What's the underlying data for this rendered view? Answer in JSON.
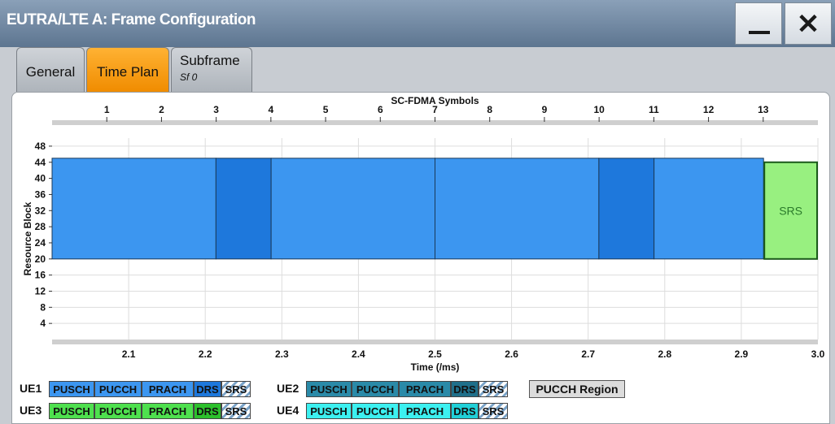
{
  "window": {
    "title": "EUTRA/LTE A: Frame Configuration"
  },
  "tabs": {
    "general": "General",
    "time_plan": "Time Plan",
    "subframe": "Subframe",
    "subframe_value": "Sf 0"
  },
  "chart_data": {
    "type": "timeplan",
    "top_axis_label": "SC-FDMA Symbols",
    "top_ticks": [
      1,
      2,
      3,
      4,
      5,
      6,
      7,
      8,
      9,
      10,
      11,
      12,
      13
    ],
    "xlabel": "Time (/ms)",
    "x_ticks": [
      "2.1",
      "2.2",
      "2.3",
      "2.4",
      "2.5",
      "2.6",
      "2.7",
      "2.8",
      "2.9",
      "3.0"
    ],
    "xlim": [
      2.0,
      3.0
    ],
    "ylabel": "Resource Block",
    "y_ticks": [
      4,
      8,
      12,
      16,
      20,
      24,
      28,
      32,
      36,
      40,
      44,
      48
    ],
    "ylim": [
      0,
      50
    ],
    "allocations": [
      {
        "channel": "PUSCH",
        "t_start": 2.0,
        "t_end": 2.214,
        "rb_start": 20,
        "rb_end": 45,
        "color": "#3c96f0"
      },
      {
        "channel": "DRS",
        "t_start": 2.214,
        "t_end": 2.286,
        "rb_start": 20,
        "rb_end": 45,
        "color": "#1e78dc"
      },
      {
        "channel": "PUSCH",
        "t_start": 2.286,
        "t_end": 2.5,
        "rb_start": 20,
        "rb_end": 45,
        "color": "#3c96f0"
      },
      {
        "channel": "PUSCH",
        "t_start": 2.5,
        "t_end": 2.714,
        "rb_start": 20,
        "rb_end": 45,
        "color": "#3c96f0"
      },
      {
        "channel": "DRS",
        "t_start": 2.714,
        "t_end": 2.786,
        "rb_start": 20,
        "rb_end": 45,
        "color": "#1e78dc"
      },
      {
        "channel": "PUSCH",
        "t_start": 2.786,
        "t_end": 2.929,
        "rb_start": 20,
        "rb_end": 45,
        "color": "#3c96f0"
      }
    ],
    "srs_block": {
      "label": "SRS",
      "t_start": 2.929,
      "t_end": 3.0,
      "rb_start": 20,
      "rb_end": 44,
      "color": "#98f080"
    }
  },
  "legend": {
    "ue1": {
      "label": "UE1",
      "items": [
        "PUSCH",
        "PUCCH",
        "PRACH",
        "DRS",
        "SRS"
      ],
      "colors": [
        "#3c96f0",
        "#3c96f0",
        "#3c96f0",
        "#1e78dc",
        "hatch"
      ]
    },
    "ue2": {
      "label": "UE2",
      "items": [
        "PUSCH",
        "PUCCH",
        "PRACH",
        "DRS",
        "SRS"
      ],
      "colors": [
        "#2a8aa8",
        "#2a8aa8",
        "#2a8aa8",
        "#1f6f8a",
        "hatch"
      ]
    },
    "ue3": {
      "label": "UE3",
      "items": [
        "PUSCH",
        "PUCCH",
        "PRACH",
        "DRS",
        "SRS"
      ],
      "colors": [
        "#4ee04e",
        "#4ee04e",
        "#4ee04e",
        "#2cc02c",
        "hatch"
      ]
    },
    "ue4": {
      "label": "UE4",
      "items": [
        "PUSCH",
        "PUCCH",
        "PRACH",
        "DRS",
        "SRS"
      ],
      "colors": [
        "#3cf0f0",
        "#3cf0f0",
        "#3cf0f0",
        "#20d0d8",
        "hatch"
      ]
    },
    "pucch_region": "PUCCH Region"
  }
}
